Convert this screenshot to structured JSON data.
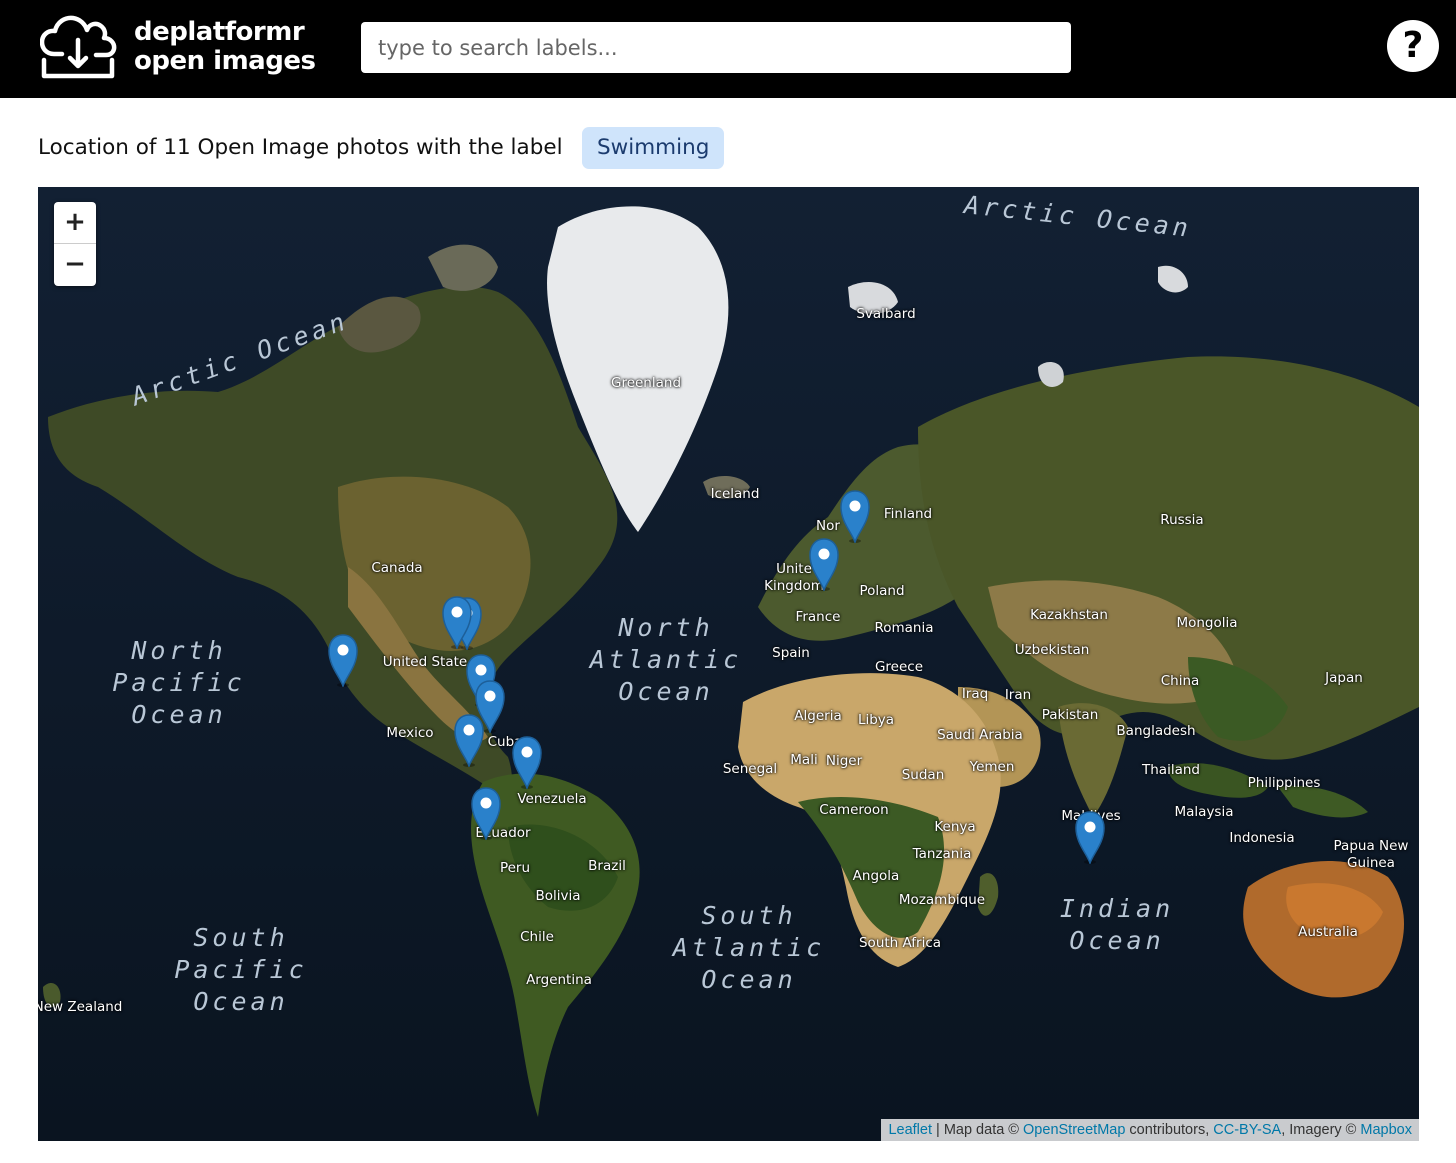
{
  "header": {
    "brand_line1": "deplatformr",
    "brand_line2": "open images",
    "logo_icon": "cloud-download-icon",
    "search_placeholder": "type to search labels...",
    "help_label": "?",
    "help_icon": "question-icon"
  },
  "caption": {
    "text": "Location of 11 Open Image photos with the label",
    "label": "Swimming"
  },
  "map": {
    "zoom_in": "+",
    "zoom_out": "−",
    "oceans": [
      {
        "key": "arctic_east",
        "lines": [
          "Arctic Ocean"
        ]
      },
      {
        "key": "arctic_west",
        "lines": [
          "Arctic Ocean"
        ]
      },
      {
        "key": "north_pacific",
        "lines": [
          "North",
          "Pacific",
          "Ocean"
        ]
      },
      {
        "key": "north_atlantic",
        "lines": [
          "North",
          "Atlantic",
          "Ocean"
        ]
      },
      {
        "key": "south_pacific",
        "lines": [
          "South",
          "Pacific",
          "Ocean"
        ]
      },
      {
        "key": "south_atlantic",
        "lines": [
          "South",
          "Atlantic",
          "Ocean"
        ]
      },
      {
        "key": "indian",
        "lines": [
          "Indian",
          "Ocean"
        ]
      }
    ],
    "places": [
      "Svalbard",
      "Greenland",
      "Iceland",
      "Finland",
      "Nor",
      "Unite",
      "Kingdom",
      "Russia",
      "Canada",
      "Poland",
      "France",
      "Romania",
      "Kazakhstan",
      "Mongolia",
      "Spain",
      "Greece",
      "Uzbekistan",
      "United State",
      "China",
      "Japan",
      "Iraq",
      "Iran",
      "Libya",
      "Algeria",
      "Pakistan",
      "Saudi Arabia",
      "Mexico",
      "Cuba",
      "Bangladesh",
      "Mali",
      "Niger",
      "Yemen",
      "Senegal",
      "Sudan",
      "Thailand",
      "Philippines",
      "Venezuela",
      "Cameroon",
      "Malaysia",
      "Maldives",
      "Kenya",
      "Ecuador",
      "Indonesia",
      "Papua New",
      "Guinea",
      "Tanzania",
      "Peru",
      "Brazil",
      "Angola",
      "Bolivia",
      "Mozambique",
      "Chile",
      "South Africa",
      "Australia",
      "Argentina",
      "New Zealand"
    ],
    "marker_count": 11,
    "marker_color": "#2a81cb",
    "attribution": {
      "leaflet": "Leaflet",
      "sep1": " | Map data © ",
      "osm": "OpenStreetMap",
      "contrib": " contributors, ",
      "license": "CC-BY-SA",
      "imagery": ", Imagery © ",
      "mapbox": "Mapbox"
    }
  }
}
